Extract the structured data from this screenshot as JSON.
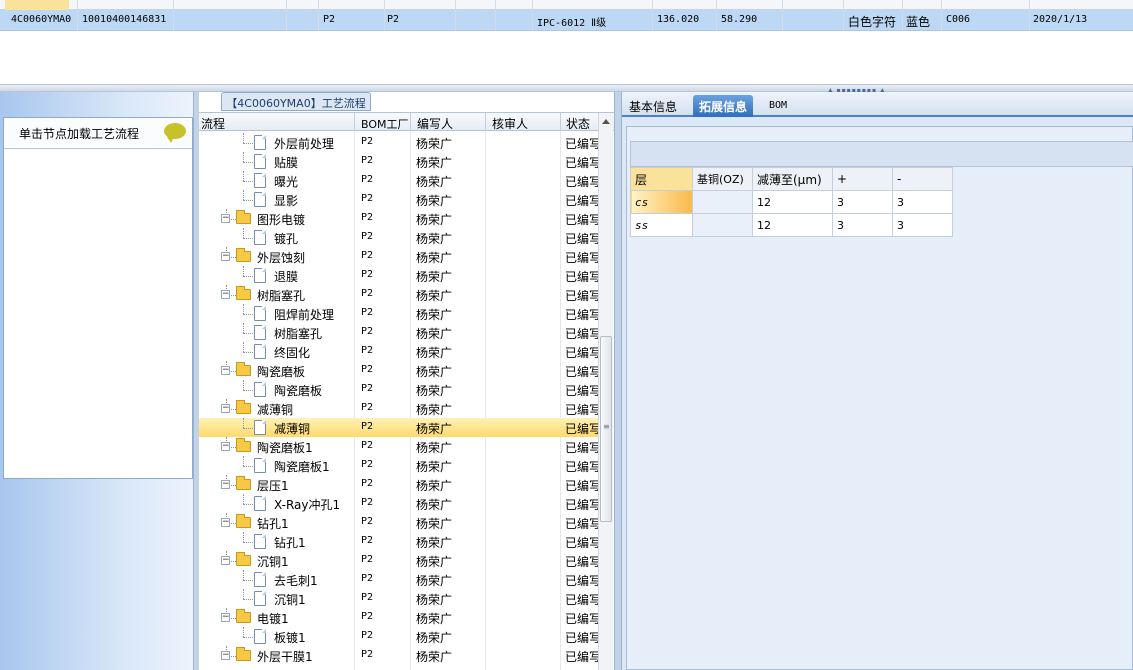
{
  "top_grid": {
    "row": {
      "code": "4C0060YMA0",
      "number": "10010400146831",
      "c1": "P2",
      "c2": "P2",
      "grade": "IPC-6012 Ⅱ级",
      "v1": "136.020",
      "v2": "58.290",
      "char_color": "白色字符",
      "mask_color": "蓝色",
      "c_code": "C006",
      "date": "2020/1/13"
    }
  },
  "left_panel": {
    "header": "单击节点加载工艺流程"
  },
  "tree": {
    "title": "【4C0060YMA0】工艺流程",
    "columns": [
      "流程",
      "BOM工厂",
      "编写人",
      "核审人",
      "状态"
    ],
    "rows": [
      {
        "name": "外层前处理",
        "type": "doc",
        "level": 2,
        "bom": "P2",
        "author": "杨荣广",
        "status": "已编写"
      },
      {
        "name": "贴膜",
        "type": "doc",
        "level": 2,
        "bom": "P2",
        "author": "杨荣广",
        "status": "已编写"
      },
      {
        "name": "曝光",
        "type": "doc",
        "level": 2,
        "bom": "P2",
        "author": "杨荣广",
        "status": "已编写"
      },
      {
        "name": "显影",
        "type": "doc",
        "level": 2,
        "bom": "P2",
        "author": "杨荣广",
        "status": "已编写"
      },
      {
        "name": "图形电镀",
        "type": "folder",
        "level": 1,
        "bom": "P2",
        "author": "杨荣广",
        "status": "已编写"
      },
      {
        "name": "镀孔",
        "type": "doc",
        "level": 2,
        "bom": "P2",
        "author": "杨荣广",
        "status": "已编写"
      },
      {
        "name": "外层蚀刻",
        "type": "folder",
        "level": 1,
        "bom": "P2",
        "author": "杨荣广",
        "status": "已编写"
      },
      {
        "name": "退膜",
        "type": "doc",
        "level": 2,
        "bom": "P2",
        "author": "杨荣广",
        "status": "已编写"
      },
      {
        "name": "树脂塞孔",
        "type": "folder",
        "level": 1,
        "bom": "P2",
        "author": "杨荣广",
        "status": "已编写"
      },
      {
        "name": "阻焊前处理",
        "type": "doc",
        "level": 2,
        "bom": "P2",
        "author": "杨荣广",
        "status": "已编写"
      },
      {
        "name": "树脂塞孔",
        "type": "doc",
        "level": 2,
        "bom": "P2",
        "author": "杨荣广",
        "status": "已编写"
      },
      {
        "name": "终固化",
        "type": "doc",
        "level": 2,
        "bom": "P2",
        "author": "杨荣广",
        "status": "已编写"
      },
      {
        "name": "陶瓷磨板",
        "type": "folder",
        "level": 1,
        "bom": "P2",
        "author": "杨荣广",
        "status": "已编写"
      },
      {
        "name": "陶瓷磨板",
        "type": "doc",
        "level": 2,
        "bom": "P2",
        "author": "杨荣广",
        "status": "已编写"
      },
      {
        "name": "减薄铜",
        "type": "folder",
        "level": 1,
        "bom": "P2",
        "author": "杨荣广",
        "status": "已编写"
      },
      {
        "name": "减薄铜",
        "type": "doc",
        "level": 2,
        "bom": "P2",
        "author": "杨荣广",
        "status": "已编写",
        "selected": true
      },
      {
        "name": "陶瓷磨板1",
        "type": "folder",
        "level": 1,
        "bom": "P2",
        "author": "杨荣广",
        "status": "已编写"
      },
      {
        "name": "陶瓷磨板1",
        "type": "doc",
        "level": 2,
        "bom": "P2",
        "author": "杨荣广",
        "status": "已编写"
      },
      {
        "name": "层压1",
        "type": "folder",
        "level": 1,
        "bom": "P2",
        "author": "杨荣广",
        "status": "已编写"
      },
      {
        "name": "X-Ray冲孔1",
        "type": "doc",
        "level": 2,
        "bom": "P2",
        "author": "杨荣广",
        "status": "已编写"
      },
      {
        "name": "钻孔1",
        "type": "folder",
        "level": 1,
        "bom": "P2",
        "author": "杨荣广",
        "status": "已编写"
      },
      {
        "name": "钻孔1",
        "type": "doc",
        "level": 2,
        "bom": "P2",
        "author": "杨荣广",
        "status": "已编写"
      },
      {
        "name": "沉铜1",
        "type": "folder",
        "level": 1,
        "bom": "P2",
        "author": "杨荣广",
        "status": "已编写"
      },
      {
        "name": "去毛刺1",
        "type": "doc",
        "level": 2,
        "bom": "P2",
        "author": "杨荣广",
        "status": "已编写"
      },
      {
        "name": "沉铜1",
        "type": "doc",
        "level": 2,
        "bom": "P2",
        "author": "杨荣广",
        "status": "已编写"
      },
      {
        "name": "电镀1",
        "type": "folder",
        "level": 1,
        "bom": "P2",
        "author": "杨荣广",
        "status": "已编写"
      },
      {
        "name": "板镀1",
        "type": "doc",
        "level": 2,
        "bom": "P2",
        "author": "杨荣广",
        "status": "已编写"
      },
      {
        "name": "外层干膜1",
        "type": "folder",
        "level": 1,
        "bom": "P2",
        "author": "杨荣广",
        "status": "已编写"
      }
    ]
  },
  "right_panel": {
    "tabs": [
      "基本信息",
      "拓展信息",
      "BOM"
    ],
    "active_tab": 1,
    "grid": {
      "columns": [
        "层",
        "基铜(OZ)",
        "减薄至(μm)",
        "+",
        "-"
      ],
      "rows": [
        {
          "layer": "cs",
          "base": "",
          "thin": "12",
          "plus": "3",
          "minus": "3"
        },
        {
          "layer": "ss",
          "base": "",
          "thin": "12",
          "plus": "3",
          "minus": "3"
        }
      ]
    }
  }
}
